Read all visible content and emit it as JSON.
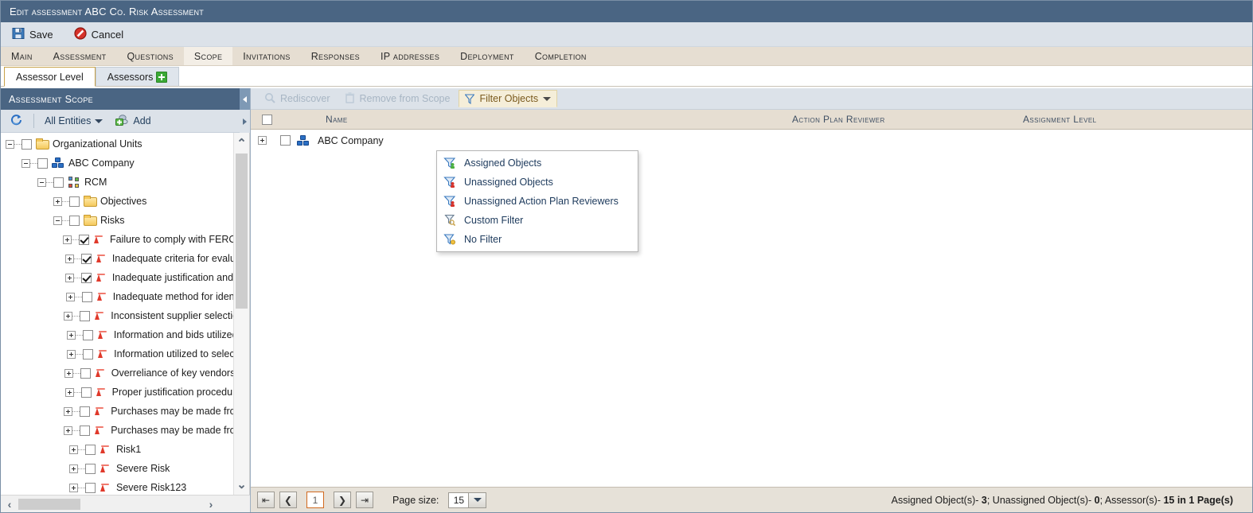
{
  "window": {
    "title": "Edit assessment ABC Co. Risk Assessment"
  },
  "command_bar": {
    "save_label": "Save",
    "cancel_label": "Cancel"
  },
  "menu_tabs": [
    {
      "label": "Main",
      "active": false
    },
    {
      "label": "Assessment",
      "active": false
    },
    {
      "label": "Questions",
      "active": false
    },
    {
      "label": "Scope",
      "active": true
    },
    {
      "label": "Invitations",
      "active": false
    },
    {
      "label": "Responses",
      "active": false
    },
    {
      "label": "IP addresses",
      "active": false
    },
    {
      "label": "Deployment",
      "active": false
    },
    {
      "label": "Completion",
      "active": false
    }
  ],
  "sub_tabs": [
    {
      "label": "Assessor Level",
      "active": true,
      "has_plus": false
    },
    {
      "label": "Assessors",
      "active": false,
      "has_plus": true
    }
  ],
  "left_panel": {
    "header": "Assessment Scope",
    "toolbar": {
      "refresh_icon": "refresh-icon",
      "entity_filter": "All Entities",
      "add_label": "Add"
    },
    "tree": [
      {
        "label": "Organizational Units",
        "depth": 0,
        "icon": "folder-icon",
        "expander": "minus",
        "checked": false
      },
      {
        "label": "ABC Company",
        "depth": 1,
        "icon": "company-icon",
        "expander": "minus",
        "checked": false
      },
      {
        "label": "RCM",
        "depth": 2,
        "icon": "rcm-icon",
        "expander": "minus",
        "checked": false
      },
      {
        "label": "Objectives",
        "depth": 3,
        "icon": "folder-icon",
        "expander": "plus",
        "checked": false
      },
      {
        "label": "Risks",
        "depth": 3,
        "icon": "folder-icon",
        "expander": "minus",
        "checked": false
      },
      {
        "label": "Failure to comply with FERC/N",
        "depth": 4,
        "icon": "risk-icon",
        "expander": "plus",
        "checked": true
      },
      {
        "label": "Inadequate criteria for evalua",
        "depth": 4,
        "icon": "risk-icon",
        "expander": "plus",
        "checked": true
      },
      {
        "label": "Inadequate justification and c",
        "depth": 4,
        "icon": "risk-icon",
        "expander": "plus",
        "checked": true
      },
      {
        "label": "Inadequate method for identi",
        "depth": 4,
        "icon": "risk-icon",
        "expander": "plus",
        "checked": false
      },
      {
        "label": "Inconsistent supplier selection",
        "depth": 4,
        "icon": "risk-icon",
        "expander": "plus",
        "checked": false
      },
      {
        "label": "Information and bids utilized",
        "depth": 4,
        "icon": "risk-icon",
        "expander": "plus",
        "checked": false
      },
      {
        "label": "Information utilized to select",
        "depth": 4,
        "icon": "risk-icon",
        "expander": "plus",
        "checked": false
      },
      {
        "label": "Overreliance of key vendors c",
        "depth": 4,
        "icon": "risk-icon",
        "expander": "plus",
        "checked": false
      },
      {
        "label": "Proper justification procedure",
        "depth": 4,
        "icon": "risk-icon",
        "expander": "plus",
        "checked": false
      },
      {
        "label": "Purchases may be made from",
        "depth": 4,
        "icon": "risk-icon",
        "expander": "plus",
        "checked": false
      },
      {
        "label": "Purchases may be made from",
        "depth": 4,
        "icon": "risk-icon",
        "expander": "plus",
        "checked": false
      },
      {
        "label": "Risk1",
        "depth": 4,
        "icon": "risk-icon",
        "expander": "plus",
        "checked": false
      },
      {
        "label": "Severe Risk",
        "depth": 4,
        "icon": "risk-icon",
        "expander": "plus",
        "checked": false
      },
      {
        "label": "Severe Risk123",
        "depth": 4,
        "icon": "risk-icon",
        "expander": "plus",
        "checked": false
      }
    ]
  },
  "grid": {
    "toolbar": {
      "rediscover_label": "Rediscover",
      "remove_label": "Remove from Scope",
      "filter_label": "Filter Objects"
    },
    "filter_menu": [
      {
        "label": "Assigned Objects",
        "icon": "filter-assigned-icon"
      },
      {
        "label": "Unassigned Objects",
        "icon": "filter-unassigned-icon"
      },
      {
        "label": "Unassigned Action Plan Reviewers",
        "icon": "filter-unassigned-reviewers-icon"
      },
      {
        "label": "Custom Filter",
        "icon": "filter-custom-icon"
      },
      {
        "label": "No Filter",
        "icon": "filter-none-icon"
      }
    ],
    "columns": [
      {
        "label": "Name"
      },
      {
        "label": "Action Plan Reviewer"
      },
      {
        "label": "Assignment Level"
      }
    ],
    "rows": [
      {
        "name": "ABC Company",
        "icon": "company-icon",
        "checked": false,
        "action_plan_reviewer": "",
        "assignment_level": ""
      }
    ]
  },
  "footer": {
    "first_page_icon": "first-page-icon",
    "prev_page_icon": "prev-page-icon",
    "current_page": "1",
    "next_page_icon": "next-page-icon",
    "last_page_icon": "last-page-icon",
    "page_size_label": "Page size:",
    "page_size_value": "15",
    "status_assigned_label": "Assigned Object(s)- ",
    "status_assigned_value": "3",
    "status_unassigned_label": "; Unassigned Object(s)- ",
    "status_unassigned_value": "0",
    "status_assessors_label": "; Assessor(s)- ",
    "status_assessors_value": "15 in 1 Page(s)"
  },
  "colors": {
    "titlebar": "#4a6583",
    "toolbar": "#dce2e9",
    "tabstrip": "#e6ded2",
    "accent_orange": "#d2691e",
    "risk_red": "#e0392b"
  }
}
